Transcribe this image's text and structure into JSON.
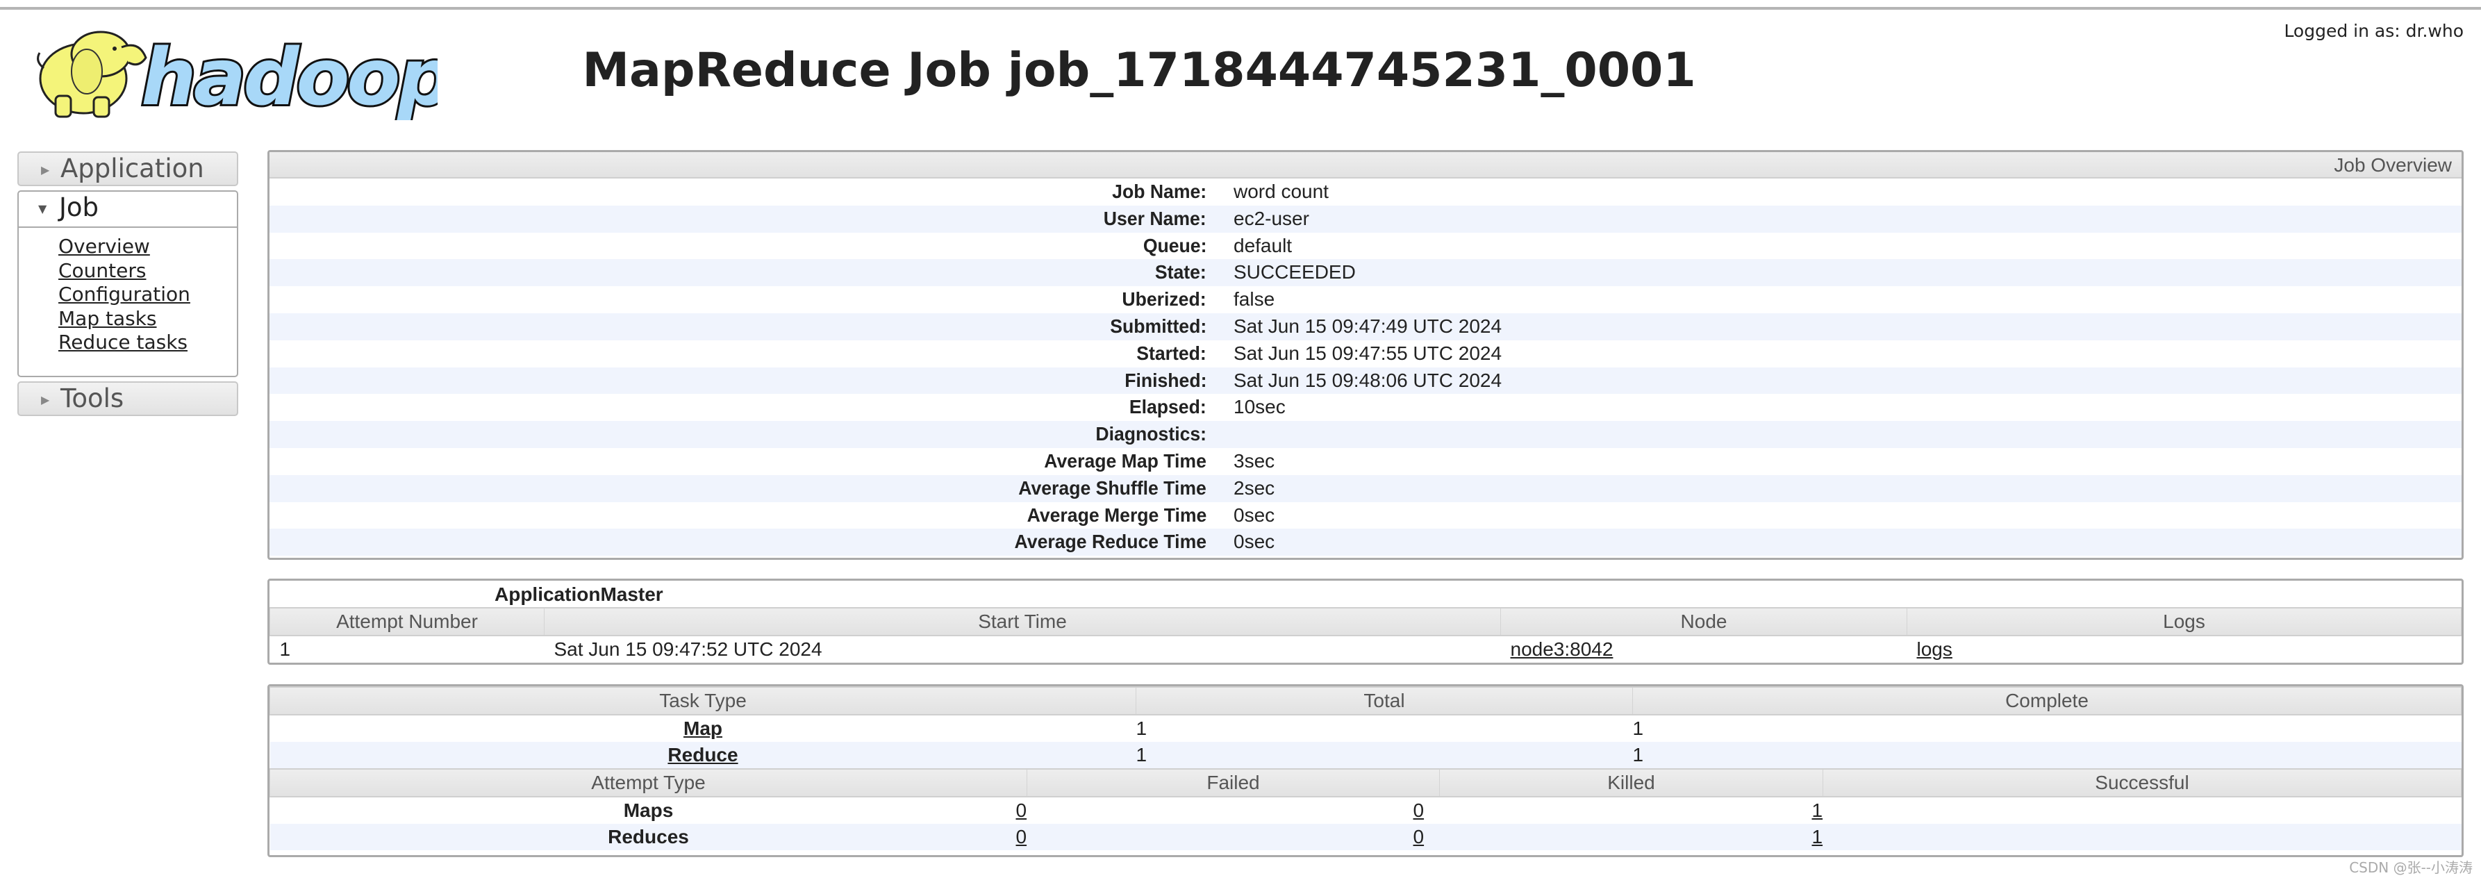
{
  "header": {
    "logo_text": "hadoop",
    "title": "MapReduce Job job_1718444745231_0001",
    "logged_in": "Logged in as: dr.who"
  },
  "sidebar": {
    "sections": [
      {
        "label": "Application",
        "expanded": false
      },
      {
        "label": "Job",
        "expanded": true,
        "items": [
          "Overview",
          "Counters",
          "Configuration",
          "Map tasks",
          "Reduce tasks"
        ]
      },
      {
        "label": "Tools",
        "expanded": false
      }
    ]
  },
  "overview": {
    "title": "Job Overview",
    "rows": [
      {
        "label": "Job Name:",
        "value": "word count"
      },
      {
        "label": "User Name:",
        "value": "ec2-user"
      },
      {
        "label": "Queue:",
        "value": "default"
      },
      {
        "label": "State:",
        "value": "SUCCEEDED"
      },
      {
        "label": "Uberized:",
        "value": "false"
      },
      {
        "label": "Submitted:",
        "value": "Sat Jun 15 09:47:49 UTC 2024"
      },
      {
        "label": "Started:",
        "value": "Sat Jun 15 09:47:55 UTC 2024"
      },
      {
        "label": "Finished:",
        "value": "Sat Jun 15 09:48:06 UTC 2024"
      },
      {
        "label": "Elapsed:",
        "value": "10sec"
      },
      {
        "label": "Diagnostics:",
        "value": ""
      },
      {
        "label": "Average Map Time",
        "value": "3sec"
      },
      {
        "label": "Average Shuffle Time",
        "value": "2sec"
      },
      {
        "label": "Average Merge Time",
        "value": "0sec"
      },
      {
        "label": "Average Reduce Time",
        "value": "0sec"
      }
    ]
  },
  "application_master": {
    "caption": "ApplicationMaster",
    "columns": [
      "Attempt Number",
      "Start Time",
      "Node",
      "Logs"
    ],
    "rows": [
      {
        "attempt": "1",
        "start_time": "Sat Jun 15 09:47:52 UTC 2024",
        "node": "node3:8042",
        "logs": "logs"
      }
    ]
  },
  "tasks": {
    "columns": [
      "Task Type",
      "Total",
      "Complete"
    ],
    "rows": [
      {
        "type": "Map",
        "total": "1",
        "complete": "1"
      },
      {
        "type": "Reduce",
        "total": "1",
        "complete": "1"
      }
    ],
    "attempt_columns": [
      "Attempt Type",
      "Failed",
      "Killed",
      "Successful"
    ],
    "attempt_rows": [
      {
        "type": "Maps",
        "failed": "0",
        "killed": "0",
        "successful": "1"
      },
      {
        "type": "Reduces",
        "failed": "0",
        "killed": "0",
        "successful": "1"
      }
    ]
  },
  "watermark": "CSDN @张--小涛涛",
  "colors": {
    "row_alt": "#f0f4fd",
    "header_bg": "#e8e8e8",
    "border": "#aaaaaa",
    "logo_blue": "#a8d8f8",
    "logo_yellow": "#f4f47a"
  }
}
